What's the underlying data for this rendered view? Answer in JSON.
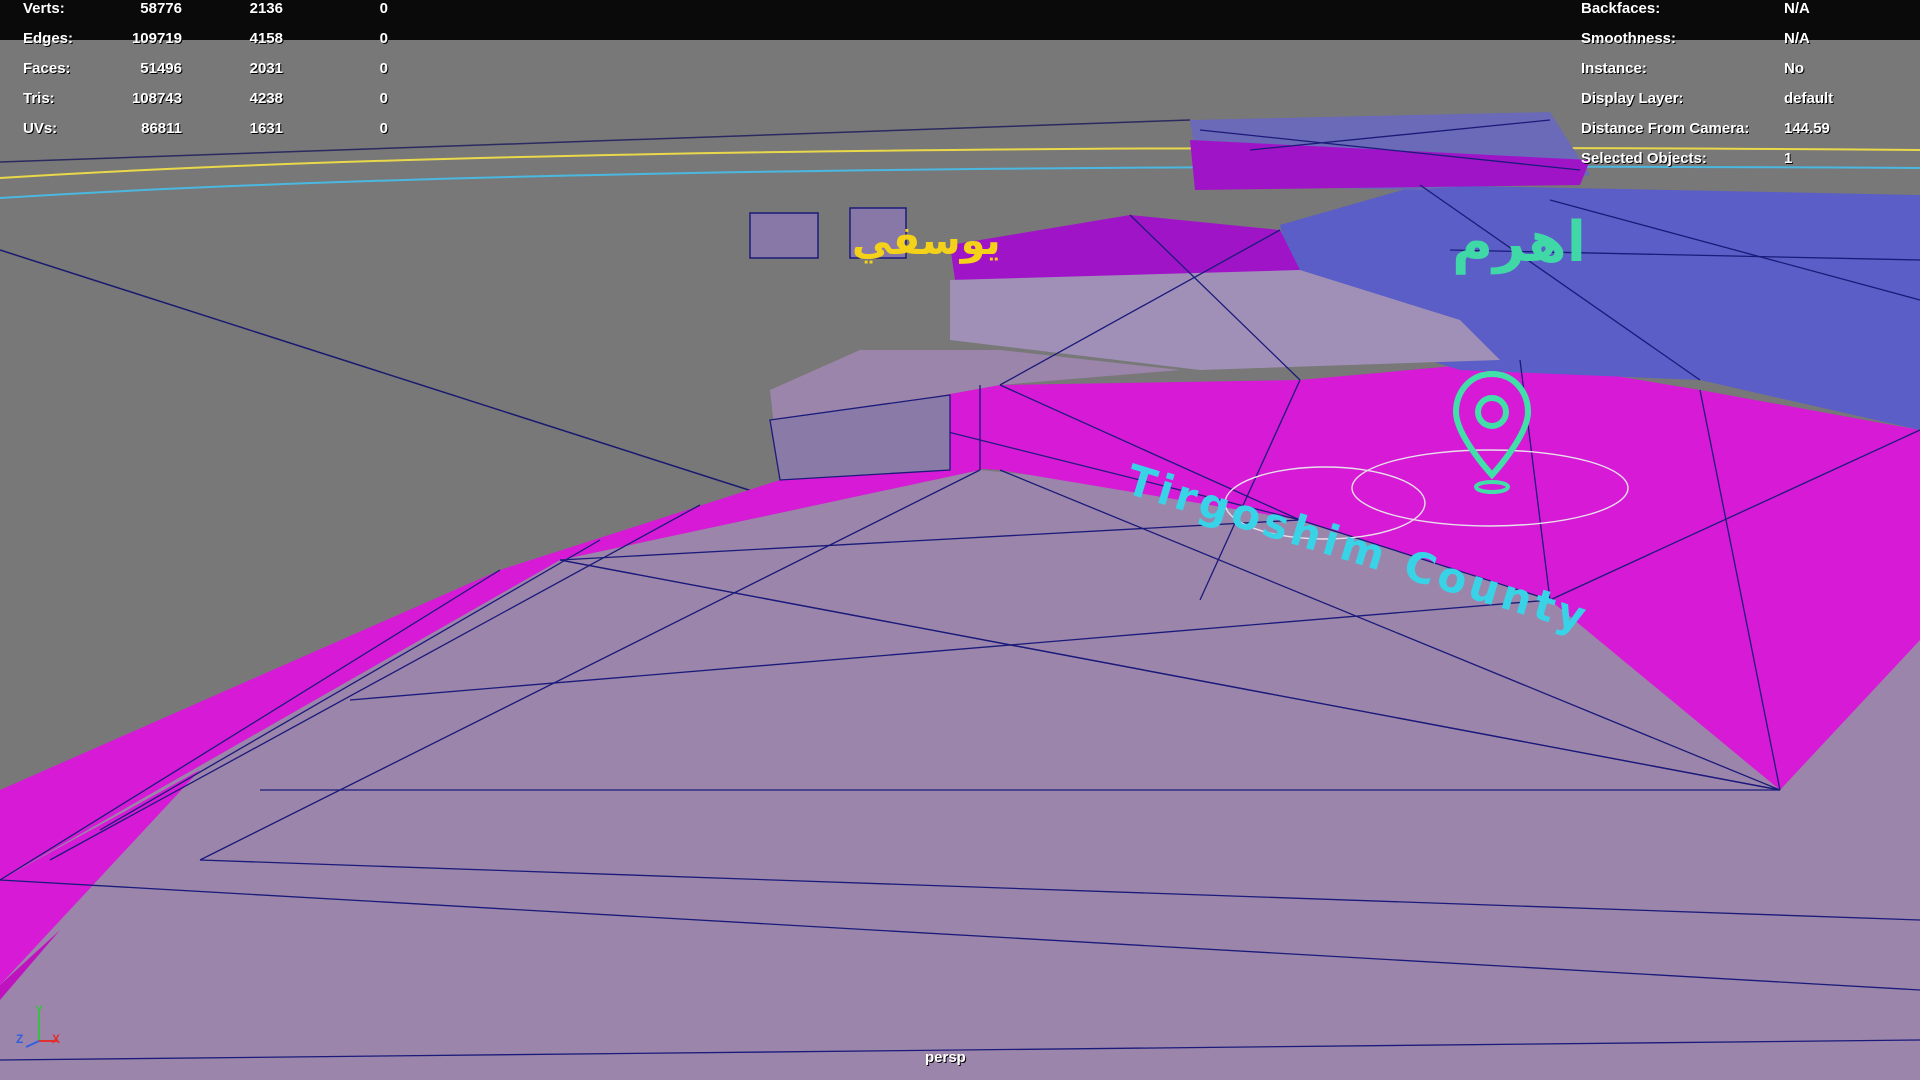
{
  "hud_left": {
    "rows": [
      {
        "label": "Verts:",
        "v1": "58776",
        "v2": "2136",
        "v3": "0"
      },
      {
        "label": "Edges:",
        "v1": "109719",
        "v2": "4158",
        "v3": "0"
      },
      {
        "label": "Faces:",
        "v1": "51496",
        "v2": "2031",
        "v3": "0"
      },
      {
        "label": "Tris:",
        "v1": "108743",
        "v2": "4238",
        "v3": "0"
      },
      {
        "label": "UVs:",
        "v1": "86811",
        "v2": "1631",
        "v3": "0"
      }
    ]
  },
  "hud_right": {
    "rows": [
      {
        "label": "Backfaces:",
        "value": "N/A"
      },
      {
        "label": "Smoothness:",
        "value": "N/A"
      },
      {
        "label": "Instance:",
        "value": "No"
      },
      {
        "label": "Display Layer:",
        "value": "default"
      },
      {
        "label": "Distance From Camera:",
        "value": "144.59"
      },
      {
        "label": "Selected Objects:",
        "value": "1"
      }
    ]
  },
  "viewport": {
    "camera": "persp",
    "axis": {
      "y": "Y",
      "z": "Z",
      "x": "X"
    }
  },
  "scene_labels": {
    "arabic_1": "يوسفي",
    "arabic_2": "اهرم",
    "county": "Tirgoshim County"
  },
  "icons": [
    "location-pin-icon",
    "axis-gizmo-icon"
  ],
  "colors": {
    "background": "#777777",
    "magenta": "#d61ad6",
    "lavender": "#9c85ab",
    "blue_region": "#5a5ec6",
    "wire": "#1a1a7a",
    "cyan_text": "#39d3e8",
    "yellow_text": "#f5d21a",
    "pin_green": "#41e0a8"
  }
}
